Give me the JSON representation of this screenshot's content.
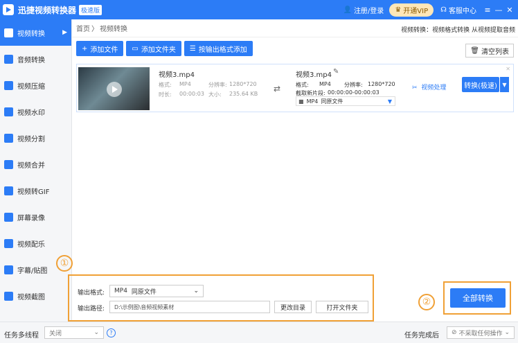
{
  "titlebar": {
    "app_title": "迅捷视频转换器",
    "edition_badge": "极速版",
    "login": "注册/登录",
    "vip": "开通VIP",
    "service": "客服中心",
    "menu_icon": "≡",
    "minimize": "—",
    "close": "✕"
  },
  "sidebar": {
    "items": [
      {
        "label": "视频转换",
        "icon": "video-convert-icon"
      },
      {
        "label": "音频转换",
        "icon": "audio-convert-icon"
      },
      {
        "label": "视频压缩",
        "icon": "video-compress-icon"
      },
      {
        "label": "视频水印",
        "icon": "watermark-icon"
      },
      {
        "label": "视频分割",
        "icon": "split-icon"
      },
      {
        "label": "视频合并",
        "icon": "merge-icon"
      },
      {
        "label": "视频转GIF",
        "icon": "gif-icon"
      },
      {
        "label": "屏幕录像",
        "icon": "record-icon"
      },
      {
        "label": "视频配乐",
        "icon": "music-icon"
      },
      {
        "label": "字幕/贴图",
        "icon": "subtitle-icon"
      },
      {
        "label": "视频截图",
        "icon": "screenshot-icon"
      }
    ]
  },
  "breadcrumb": {
    "home": "首页",
    "sep": "〉",
    "current": "视频转换",
    "hint": "视频转换：视频格式转换 从视频提取音频"
  },
  "toolbar": {
    "add_file": "添加文件",
    "add_folder": "添加文件夹",
    "add_by_format": "按输出格式添加",
    "clear_list": "清空列表"
  },
  "file": {
    "source_name": "视频3.mp4",
    "format_label": "格式:",
    "format": "MP4",
    "resolution_label": "分辨率:",
    "resolution": "1280*720",
    "duration_label": "时长:",
    "duration": "00:00:03",
    "size_label": "大小:",
    "size": "235.64 KB",
    "output_name": "视频3.mp4",
    "clip_label": "截取新片段:",
    "clip_range": "00:00:00-00:00:03",
    "output_format": "MP4",
    "output_quality": "同原文件",
    "process": "视频处理",
    "convert": "转换(极速)"
  },
  "bottom": {
    "format_label": "输出格式:",
    "format_value": "MP4",
    "format_quality": "同原文件",
    "path_label": "输出路径:",
    "path_value": "D:\\示例图\\音频视频素材",
    "change_dir": "更改目录",
    "open_folder": "打开文件夹",
    "marker_one": "①",
    "marker_two": "②",
    "convert_all": "全部转换"
  },
  "status": {
    "multithread_label": "任务多线程",
    "multithread_value": "关闭",
    "help": "?",
    "after_label": "任务完成后",
    "after_value": "不采取任何操作"
  }
}
